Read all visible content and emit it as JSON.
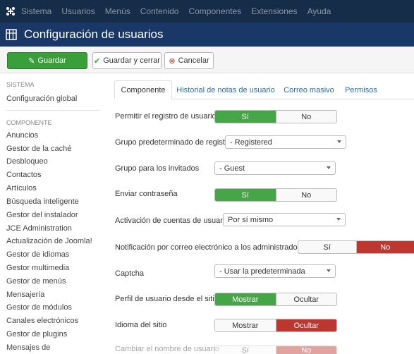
{
  "topbar": {
    "items": [
      "Sistema",
      "Usuarios",
      "Menús",
      "Contenido",
      "Componentes",
      "Extensiones",
      "Ayuda"
    ]
  },
  "header": {
    "title": "Configuración de usuarios",
    "icon": "users-grid-icon"
  },
  "toolbar": {
    "save_label": "Guardar",
    "save_close_label": "Guardar y cerrar",
    "cancel_label": "Cancelar"
  },
  "sidebar": {
    "sistema_heading": "SISTEMA",
    "global_config": "Configuración global",
    "componente_heading": "COMPONENTE",
    "items": [
      "Anuncios",
      "Gestor de la caché",
      "Desbloqueo",
      "Contactos",
      "Artículos",
      "Búsqueda inteligente",
      "Gestor del instalador",
      "JCE Administration",
      "Actualización de Joomla!",
      "Gestor de idiomas",
      "Gestor multimedia",
      "Gestor de menús",
      "Mensajería",
      "Gestor de módulos",
      "Canales electrónicos",
      "Gestor de plugins",
      "Mensajes de"
    ]
  },
  "tabs": [
    "Componente",
    "Historial de notas de usuario",
    "Correo masivo",
    "Permisos"
  ],
  "form": {
    "registro": {
      "label": "Permitir el registro de usuarios",
      "yes": "Sí",
      "no": "No"
    },
    "grupo_registro": {
      "label": "Grupo predeterminado de registro",
      "value": "- Registered"
    },
    "grupo_invitados": {
      "label": "Grupo para los invitados",
      "value": "- Guest"
    },
    "enviar_pass": {
      "label": "Enviar contraseña",
      "yes": "Sí",
      "no": "No"
    },
    "activacion": {
      "label": "Activación de cuentas de usuario",
      "value": "Por sí mismo"
    },
    "notificacion": {
      "label": "Notificación por correo electrónico a los administradores",
      "yes": "Sí",
      "no": "No"
    },
    "captcha": {
      "label": "Captcha",
      "value": "- Usar la predeterminada"
    },
    "perfil": {
      "label": "Perfil de usuario desde el sitio",
      "show": "Mostrar",
      "hide": "Ocultar"
    },
    "idioma": {
      "label": "Idioma del sitio",
      "show": "Mostrar",
      "hide": "Ocultar"
    },
    "cambiar": {
      "label": "Cambiar el nombre de usuario",
      "yes": "Sí",
      "no": "No"
    }
  },
  "colors": {
    "green": "#46a546",
    "red": "#bd362f",
    "header": "#1a3867",
    "topbar": "#162d4a"
  }
}
